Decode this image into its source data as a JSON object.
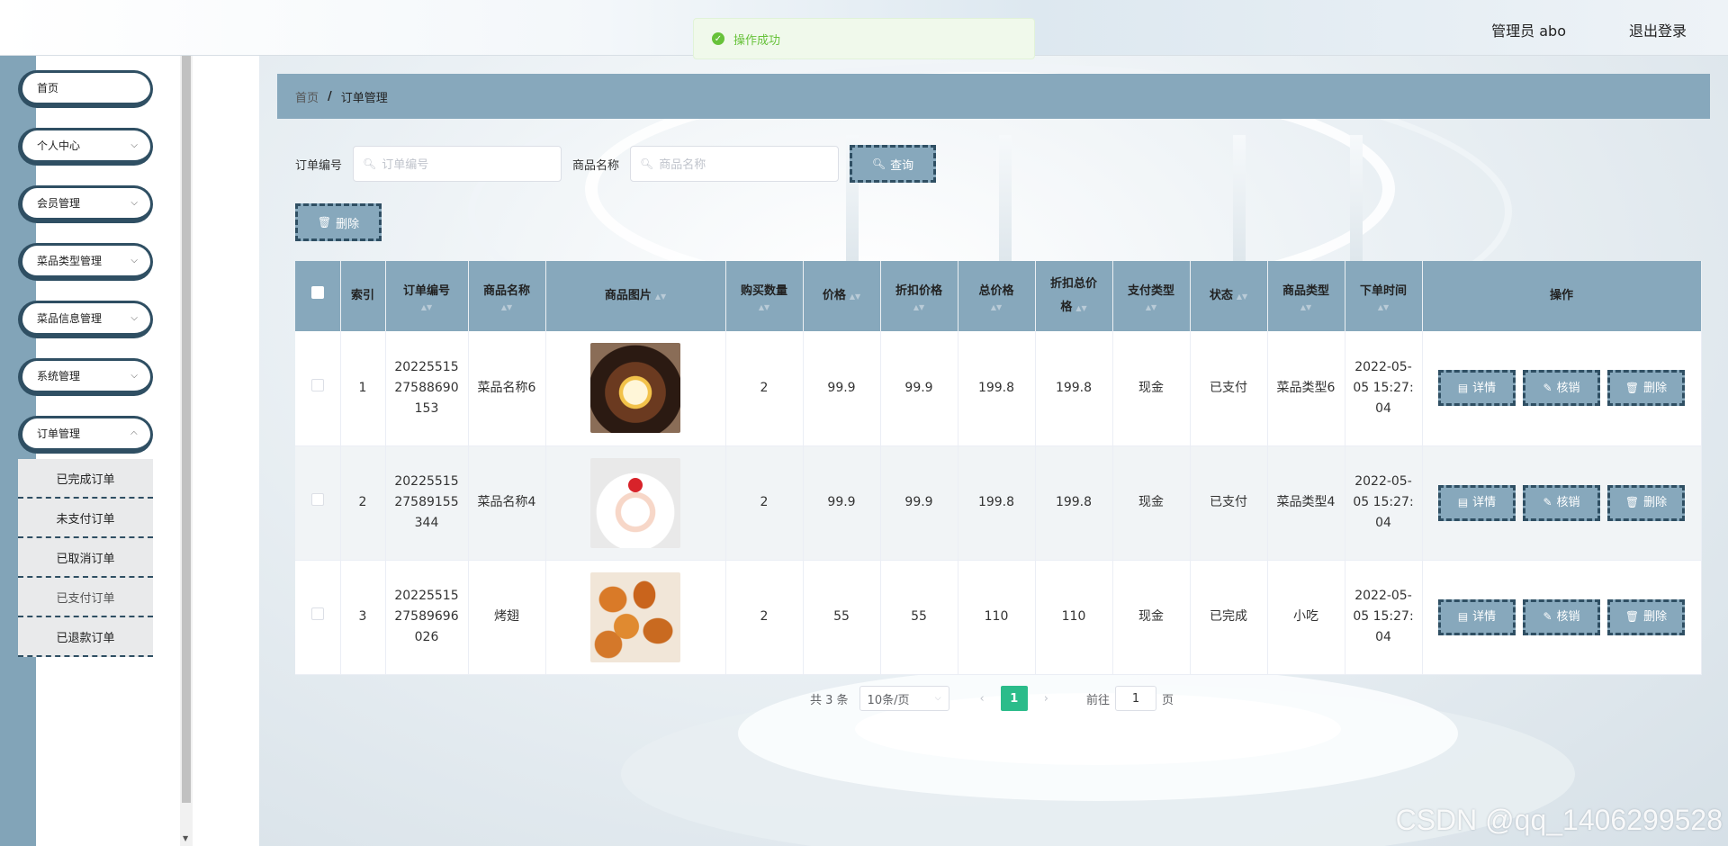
{
  "toast": {
    "text": "操作成功"
  },
  "header": {
    "user": "管理员 abo",
    "logout": "退出登录"
  },
  "sidebar": {
    "items": [
      {
        "label": "首页"
      },
      {
        "label": "个人中心"
      },
      {
        "label": "会员管理"
      },
      {
        "label": "菜品类型管理"
      },
      {
        "label": "菜品信息管理"
      },
      {
        "label": "系统管理"
      },
      {
        "label": "订单管理"
      }
    ],
    "chevron": "⌵",
    "order_submenu": [
      {
        "label": "已完成订单"
      },
      {
        "label": "未支付订单"
      },
      {
        "label": "已取消订单"
      },
      {
        "label": "已支付订单"
      },
      {
        "label": "已退款订单"
      }
    ]
  },
  "breadcrumb": {
    "home": "首页",
    "separator": "/",
    "current": "订单管理"
  },
  "filters": {
    "order_no_label": "订单编号",
    "order_no_placeholder": "订单编号",
    "product_name_label": "商品名称",
    "product_name_placeholder": "商品名称",
    "query_button": "查询",
    "delete_button": "删除"
  },
  "table": {
    "headers": {
      "index": "索引",
      "order_no": "订单编号",
      "product_name": "商品名称",
      "product_image": "商品图片",
      "quantity": "购买数量",
      "price": "价格",
      "discount_price": "折扣价格",
      "total_price": "总价格",
      "discount_total_line1": "折扣总价",
      "discount_total_line2": "格",
      "pay_type": "支付类型",
      "status": "状态",
      "product_type": "商品类型",
      "order_time": "下单时间",
      "actions": "操作"
    },
    "rows": [
      {
        "index": "1",
        "order_no_1": "20225515",
        "order_no_2": "27588690",
        "order_no_3": "153",
        "product_name": "菜品名称6",
        "quantity": "2",
        "price": "99.9",
        "discount_price": "99.9",
        "total_price": "199.8",
        "discount_total": "199.8",
        "pay_type": "现金",
        "status": "已支付",
        "product_type": "菜品类型6",
        "time_1": "2022-05-",
        "time_2": "05 15:27:",
        "time_3": "04"
      },
      {
        "index": "2",
        "order_no_1": "20225515",
        "order_no_2": "27589155",
        "order_no_3": "344",
        "product_name": "菜品名称4",
        "quantity": "2",
        "price": "99.9",
        "discount_price": "99.9",
        "total_price": "199.8",
        "discount_total": "199.8",
        "pay_type": "现金",
        "status": "已支付",
        "product_type": "菜品类型4",
        "time_1": "2022-05-",
        "time_2": "05 15:27:",
        "time_3": "04"
      },
      {
        "index": "3",
        "order_no_1": "20225515",
        "order_no_2": "27589696",
        "order_no_3": "026",
        "product_name": "烤翅",
        "quantity": "2",
        "price": "55",
        "discount_price": "55",
        "total_price": "110",
        "discount_total": "110",
        "pay_type": "现金",
        "status": "已完成",
        "product_type": "小吃",
        "time_1": "2022-05-",
        "time_2": "05 15:27:",
        "time_3": "04"
      }
    ],
    "action_labels": {
      "detail": "详情",
      "verify": "核销",
      "delete": "删除"
    }
  },
  "pagination": {
    "total": "共 3 条",
    "page_size": "10条/页",
    "current_page": "1",
    "goto_label": "前往",
    "goto_value": "1",
    "page_unit": "页"
  },
  "watermark": "CSDN @qq_1406299528",
  "colors": {
    "accent": "#87a8bc",
    "dark_border": "#2f4f63",
    "active_page": "#2bbc8a",
    "success": "#67c23a"
  }
}
